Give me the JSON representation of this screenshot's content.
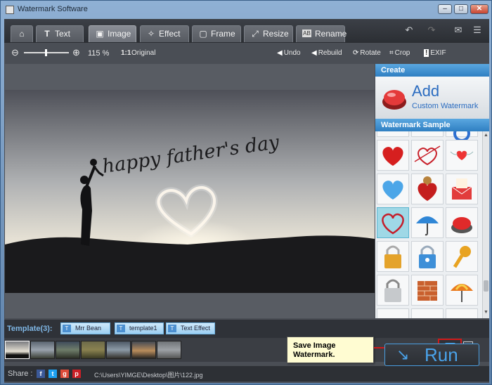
{
  "window": {
    "title": "Watermark Software"
  },
  "tabs": [
    {
      "label": "",
      "icon": "home-icon"
    },
    {
      "label": "Text",
      "icon": "text-icon"
    },
    {
      "label": "Image",
      "icon": "image-icon"
    },
    {
      "label": "Effect",
      "icon": "effect-icon"
    },
    {
      "label": "Frame",
      "icon": "frame-icon"
    },
    {
      "label": "Resize",
      "icon": "resize-icon"
    },
    {
      "label": "Rename",
      "icon": "rename-icon"
    }
  ],
  "active_tab": "Image",
  "zoom": {
    "level": "115 %",
    "original_label": "Original",
    "original_icon_text": "1:1"
  },
  "actions": {
    "undo": "Undo",
    "rebuild": "Rebuild",
    "rotate": "Rotate",
    "crop": "Crop",
    "exif": "EXIF"
  },
  "panel": {
    "create_header": "Create",
    "add_title": "Add",
    "add_subtitle": "Custom Watermark",
    "sample_header": "Watermark Sample",
    "sample_selected": 6
  },
  "photo": {
    "handwriting": "happy father's day"
  },
  "template": {
    "label": "Template(3):",
    "items": [
      {
        "label": "Mrr Bean"
      },
      {
        "label": "template1"
      },
      {
        "label": "Text Effect ..."
      }
    ]
  },
  "callout": {
    "line1": "Save Image",
    "line2": "Watermark."
  },
  "run_label": "Run",
  "status": {
    "share_label": "Share :",
    "path": "C:\\Users\\YIMGE\\Desktop\\图片\\122.jpg"
  },
  "colors": {
    "accent": "#4aa3ea",
    "panel_header": "#2f7fc2",
    "highlight_red": "#d01919",
    "selected_cell": "#9fd8e6"
  }
}
